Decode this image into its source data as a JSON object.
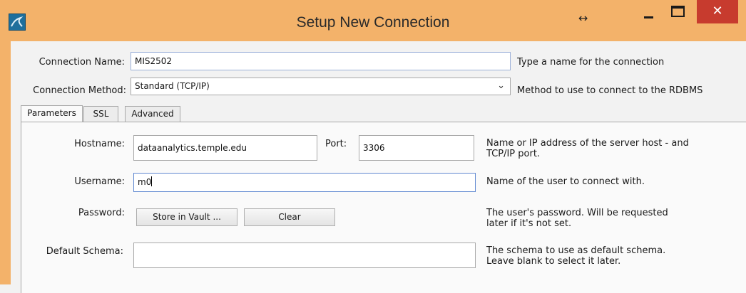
{
  "window": {
    "title": "Setup New Connection",
    "resize_icon": "↔",
    "close_glyph": "✕",
    "icon": "mysql-workbench-icon"
  },
  "form": {
    "connection_name_label": "Connection Name:",
    "connection_name_value": "MIS2502",
    "connection_name_hint": "Type a name for the connection",
    "connection_method_label": "Connection Method:",
    "connection_method_value": "Standard (TCP/IP)",
    "connection_method_hint": "Method to use to connect to the RDBMS"
  },
  "tabs": [
    {
      "label": "Parameters",
      "active": true
    },
    {
      "label": "SSL",
      "active": false
    },
    {
      "label": "Advanced",
      "active": false
    }
  ],
  "parameters": {
    "hostname_label": "Hostname:",
    "hostname_value": "dataanalytics.temple.edu",
    "port_label": "Port:",
    "port_value": "3306",
    "hostname_hint_line1": "Name or IP address of the server host - and",
    "hostname_hint_line2": "TCP/IP port.",
    "username_label": "Username:",
    "username_value": "m0",
    "username_hint": "Name of the user to connect with.",
    "password_label": "Password:",
    "store_in_vault_label": "Store in Vault ...",
    "clear_label": "Clear",
    "password_hint_line1": "The user's password. Will be requested",
    "password_hint_line2": "later if it's not set.",
    "default_schema_label": "Default Schema:",
    "default_schema_value": "",
    "default_schema_hint_line1": "The schema to use as default schema.",
    "default_schema_hint_line2": "Leave blank to select it later."
  },
  "colors": {
    "title_bar": "#f3b26a",
    "close_button": "#c73b2e"
  }
}
